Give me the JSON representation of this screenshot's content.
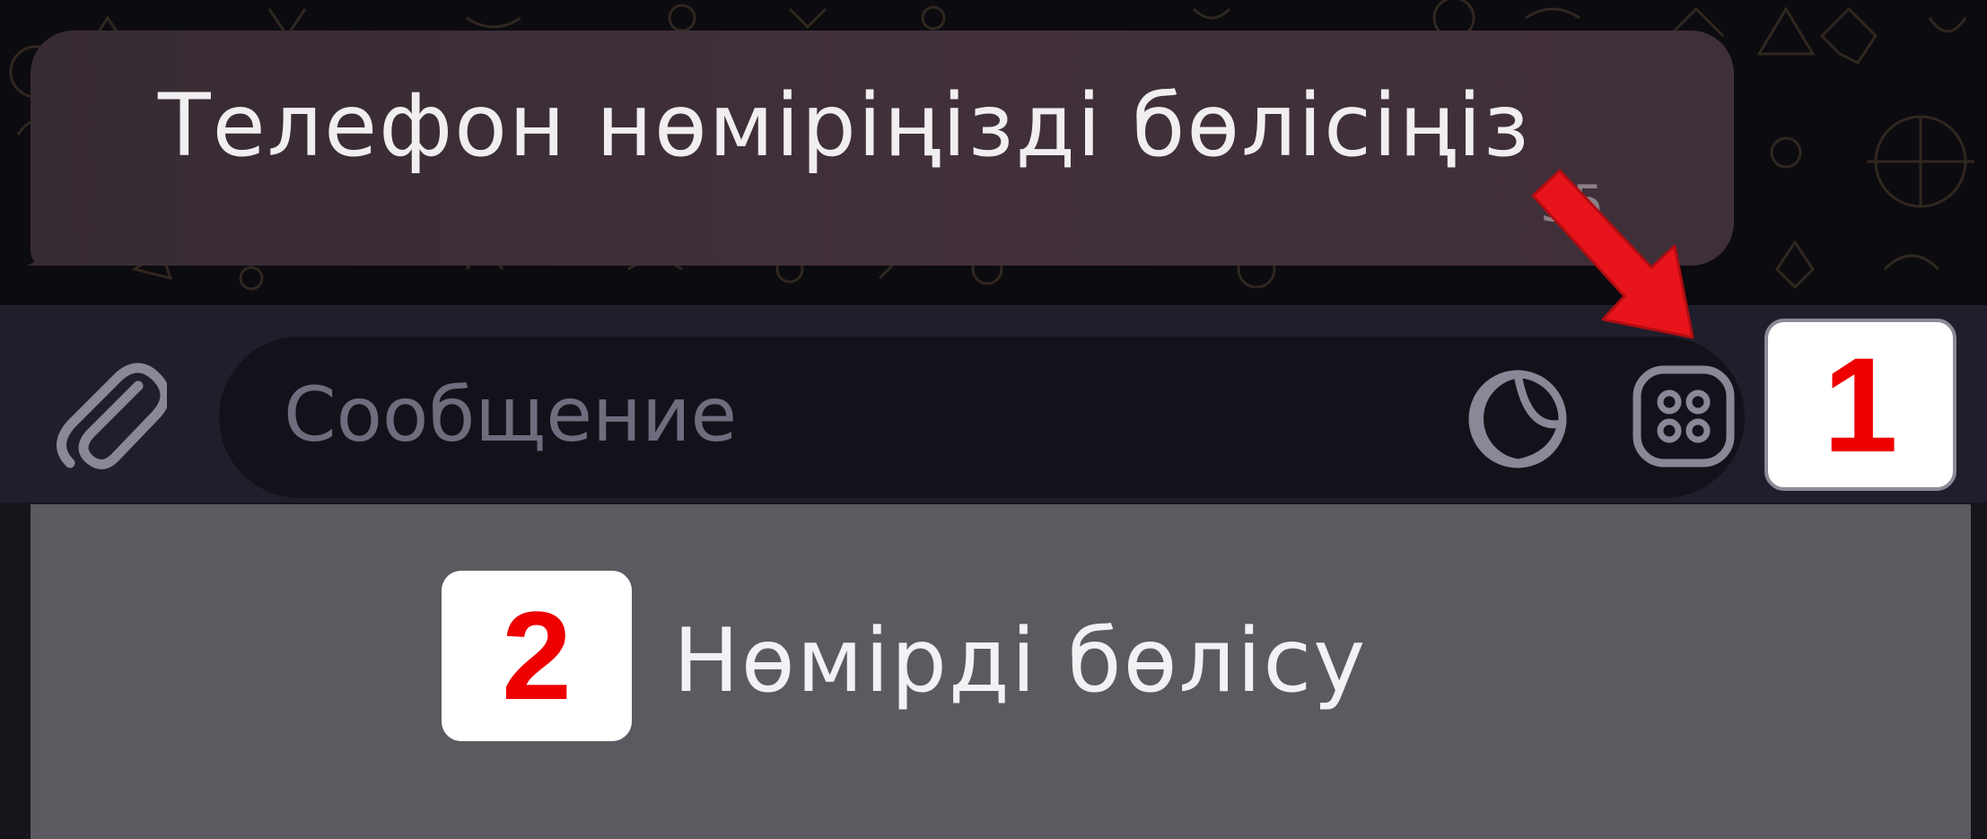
{
  "chat": {
    "message_text": "Телефон нөміріңізді бөлісіңіз",
    "message_time": "55"
  },
  "composer": {
    "placeholder": "Сообщение",
    "attach_icon": "paperclip-icon",
    "sticker_icon": "sticker-icon",
    "keyboard_icon": "bot-keyboard-icon"
  },
  "keyboard": {
    "share_number_label": "Нөмірді бөлісу"
  },
  "annotations": {
    "step1": "1",
    "step2": "2",
    "arrow_color": "#e8141c"
  },
  "colors": {
    "bubble": "#3f2f38",
    "input_bar": "#201e2b",
    "key_button": "#5c5a60"
  }
}
